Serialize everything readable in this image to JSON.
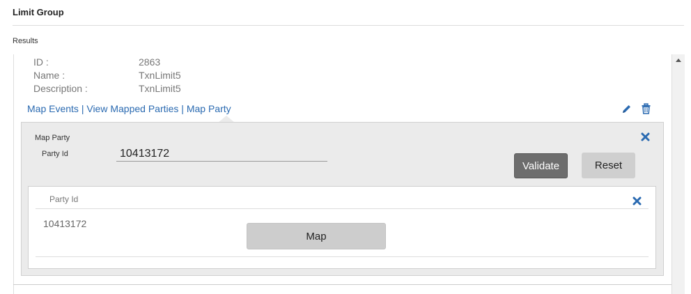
{
  "page": {
    "title": "Limit Group",
    "results_label": "Results"
  },
  "record": {
    "id_label": "ID :",
    "id_value": "2863",
    "name_label": "Name :",
    "name_value": "TxnLimit5",
    "desc_label": "Description :",
    "desc_value": "TxnLimit5"
  },
  "links": {
    "map_events": "Map Events",
    "separator": " | ",
    "view_mapped": "View Mapped Parties",
    "map_party": "Map Party"
  },
  "icons": {
    "edit": "pencil-icon",
    "delete": "trash-icon",
    "close": "close-icon"
  },
  "colors": {
    "link": "#2a6ab1",
    "panel_bg": "#ebebeb",
    "validate_bg": "#6d6d6d",
    "button_bg": "#cfcfcf"
  },
  "map_party_form": {
    "section_title": "Map Party",
    "party_id_label": "Party Id",
    "party_id_value": "10413172",
    "validate_label": "Validate",
    "reset_label": "Reset"
  },
  "results_table": {
    "column_header": "Party Id",
    "rows": [
      {
        "party_id": "10413172",
        "action_label": "Map"
      }
    ]
  }
}
